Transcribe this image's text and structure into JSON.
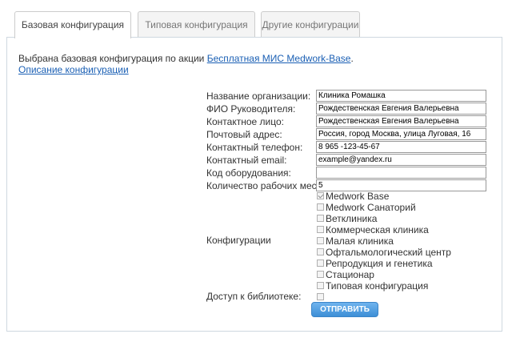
{
  "tabs": [
    "Базовая конфигурация",
    "Типовая конфигурация",
    "Другие конфигурации"
  ],
  "intro": {
    "text": "Выбрана базовая конфигурация по акции ",
    "link": "Бесплатная МИС Medwork-Base",
    "period": ".",
    "description_link": "Описание конфигурации"
  },
  "form": {
    "fields": [
      {
        "label": "Название организации:",
        "value": "Клиника Ромашка"
      },
      {
        "label": "ФИО Руководителя:",
        "value": "Рождественская Евгения Валерьевна"
      },
      {
        "label": "Контактное лицо:",
        "value": "Рождественская Евгения Валерьевна"
      },
      {
        "label": "Почтовый адрес:",
        "value": "Россия, город Москва, улица Луговая, 16"
      },
      {
        "label": "Контактный телефон:",
        "value": "8 965 -123-45-67"
      },
      {
        "label": "Контактный email:",
        "value": "example@yandex.ru"
      },
      {
        "label": "Код оборудования:",
        "value": ""
      },
      {
        "label": "Количество рабочих мест:",
        "value": "5"
      }
    ],
    "configs_label": "Конфигурации",
    "configs": [
      {
        "label": "Medwork Base",
        "checked": true
      },
      {
        "label": "Medwork Санаторий",
        "checked": false
      },
      {
        "label": "Ветклиника",
        "checked": false
      },
      {
        "label": "Коммерческая клиника",
        "checked": false
      },
      {
        "label": "Малая клиника",
        "checked": false
      },
      {
        "label": "Офтальмологический центр",
        "checked": false
      },
      {
        "label": "Репродукция и генетика",
        "checked": false
      },
      {
        "label": "Стационар",
        "checked": false
      },
      {
        "label": "Типовая конфигурация",
        "checked": false
      }
    ],
    "library_label": "Доступ к библиотеке:",
    "submit_label": "ОТПРАВИТЬ"
  }
}
